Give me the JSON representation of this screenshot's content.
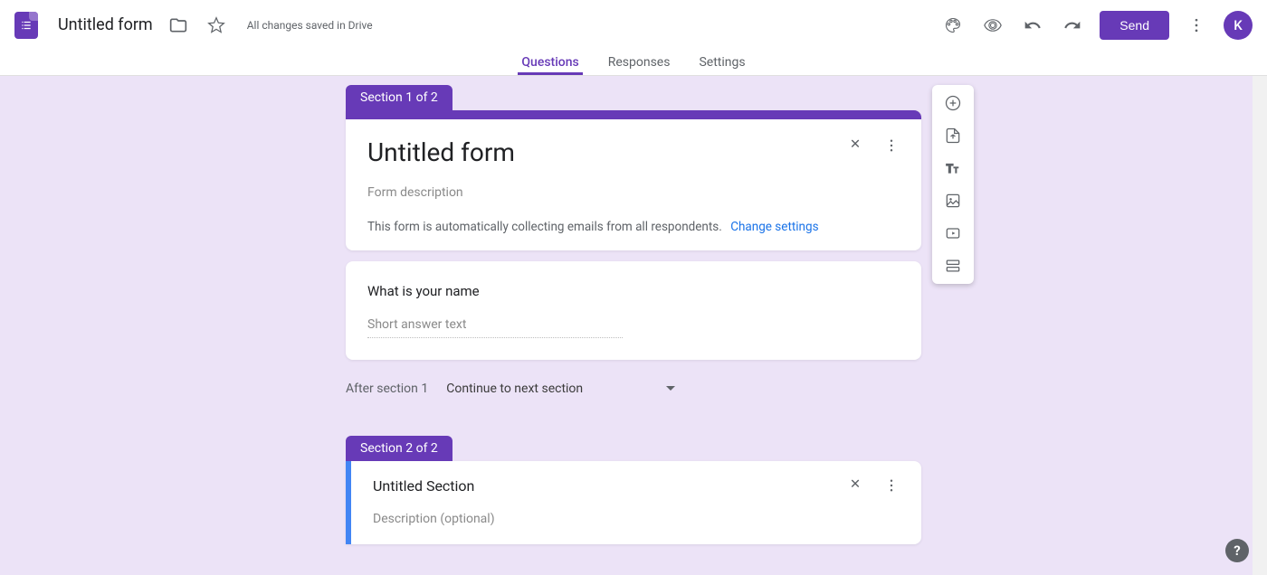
{
  "header": {
    "form_title": "Untitled form",
    "save_status": "All changes saved in Drive",
    "send_label": "Send",
    "avatar_letter": "K"
  },
  "tabs": {
    "questions": "Questions",
    "responses": "Responses",
    "settings": "Settings"
  },
  "section1": {
    "label": "Section 1 of 2",
    "title": "Untitled form",
    "description_placeholder": "Form description",
    "email_notice": "This form is automatically collecting emails from all respondents.",
    "change_link": "Change settings"
  },
  "question1": {
    "text": "What is your name",
    "placeholder": "Short answer text"
  },
  "after_section": {
    "label": "After section 1",
    "action": "Continue to next section"
  },
  "section2": {
    "label": "Section 2 of 2",
    "title": "Untitled Section",
    "description_placeholder": "Description (optional)"
  }
}
